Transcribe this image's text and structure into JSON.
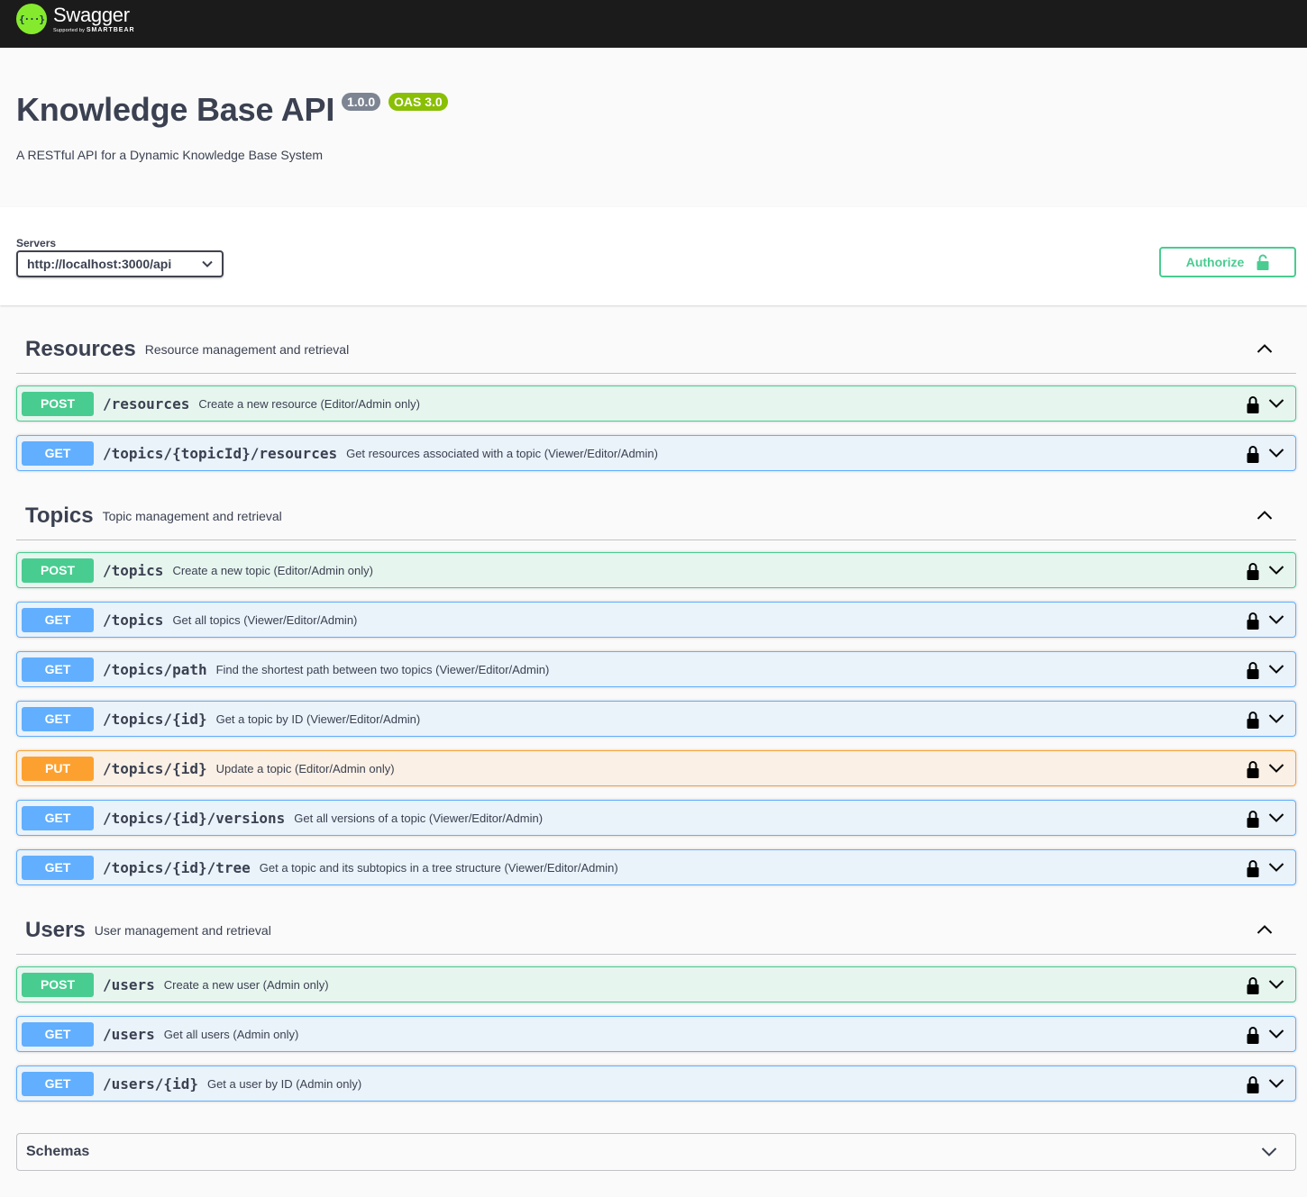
{
  "topbar": {
    "brand": "Swagger",
    "supported_by": "Supported by",
    "company": "SMARTBEAR",
    "logo_glyph": "{···}"
  },
  "info": {
    "title": "Knowledge Base API",
    "version": "1.0.0",
    "oas": "OAS 3.0",
    "description": "A RESTful API for a Dynamic Knowledge Base System"
  },
  "servers": {
    "label": "Servers",
    "selected": "http://localhost:3000/api"
  },
  "authorize": {
    "label": "Authorize"
  },
  "tags": [
    {
      "name": "Resources",
      "description": "Resource management and retrieval",
      "operations": [
        {
          "method": "POST",
          "path": "/resources",
          "summary": "Create a new resource (Editor/Admin only)"
        },
        {
          "method": "GET",
          "path": "/topics/{topicId}/resources",
          "summary": "Get resources associated with a topic (Viewer/Editor/Admin)"
        }
      ]
    },
    {
      "name": "Topics",
      "description": "Topic management and retrieval",
      "operations": [
        {
          "method": "POST",
          "path": "/topics",
          "summary": "Create a new topic (Editor/Admin only)"
        },
        {
          "method": "GET",
          "path": "/topics",
          "summary": "Get all topics (Viewer/Editor/Admin)"
        },
        {
          "method": "GET",
          "path": "/topics/path",
          "summary": "Find the shortest path between two topics (Viewer/Editor/Admin)"
        },
        {
          "method": "GET",
          "path": "/topics/{id}",
          "summary": "Get a topic by ID (Viewer/Editor/Admin)"
        },
        {
          "method": "PUT",
          "path": "/topics/{id}",
          "summary": "Update a topic (Editor/Admin only)"
        },
        {
          "method": "GET",
          "path": "/topics/{id}/versions",
          "summary": "Get all versions of a topic (Viewer/Editor/Admin)"
        },
        {
          "method": "GET",
          "path": "/topics/{id}/tree",
          "summary": "Get a topic and its subtopics in a tree structure (Viewer/Editor/Admin)"
        }
      ]
    },
    {
      "name": "Users",
      "description": "User management and retrieval",
      "operations": [
        {
          "method": "POST",
          "path": "/users",
          "summary": "Create a new user (Admin only)"
        },
        {
          "method": "GET",
          "path": "/users",
          "summary": "Get all users (Admin only)"
        },
        {
          "method": "GET",
          "path": "/users/{id}",
          "summary": "Get a user by ID (Admin only)"
        }
      ]
    }
  ],
  "schemas": {
    "title": "Schemas"
  },
  "icons": {
    "lock": "lock-icon",
    "expand": "chevron-down-icon",
    "collapse": "chevron-up-icon",
    "select": "chevron-down-icon"
  },
  "colors": {
    "post": "#49cc90",
    "get": "#61affe",
    "put": "#fca130",
    "topbar": "#1b1b1b",
    "logo": "#85ea2d",
    "version_badge": "#7d8492",
    "oas_badge": "#89bf04"
  }
}
